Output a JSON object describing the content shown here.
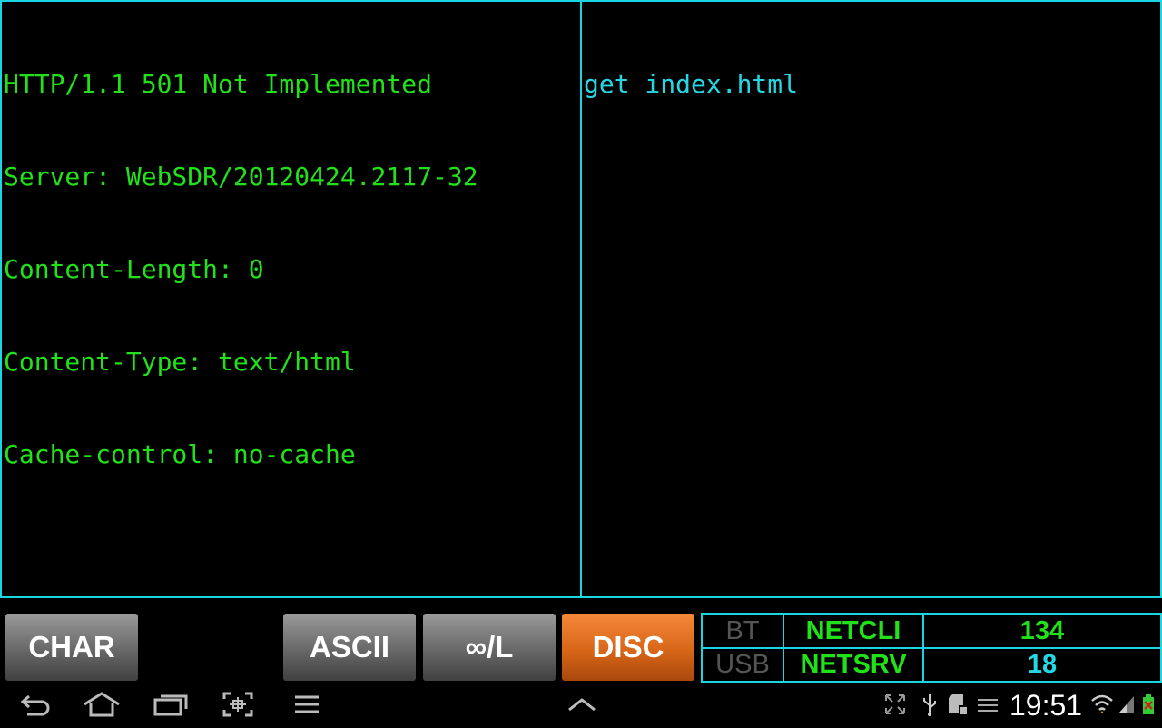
{
  "terminal": {
    "left_lines": [
      "HTTP/1.1 501 Not Implemented",
      "Server: WebSDR/20120424.2117-32",
      "Content-Length: 0",
      "Content-Type: text/html",
      "Cache-control: no-cache"
    ],
    "right_lines": [
      "get index.html"
    ]
  },
  "controls": {
    "char_label": "CHAR",
    "ascii_label": "ASCII",
    "loop_label": "∞/L",
    "disc_label": "DISC"
  },
  "status": {
    "bt_label": "BT",
    "usb_label": "USB",
    "netcli_label": "NETCLI",
    "netsrv_label": "NETSRV",
    "netcli_count": "134",
    "netsrv_count": "18"
  },
  "system_bar": {
    "time": "19:51",
    "icons": [
      "back-icon",
      "home-icon",
      "recent-apps-icon",
      "screenshot-icon",
      "menu-icon",
      "up-chevron-icon",
      "fullscreen-icon",
      "usb-icon",
      "sd-card-icon",
      "app-notification-icon",
      "wifi-icon",
      "signal-icon",
      "battery-icon"
    ],
    "colors": {
      "accent": "#1ad6e2",
      "terminal_green": "#22e11a",
      "terminal_cyan": "#25d7e3",
      "disc_orange": "#e0701f"
    }
  }
}
